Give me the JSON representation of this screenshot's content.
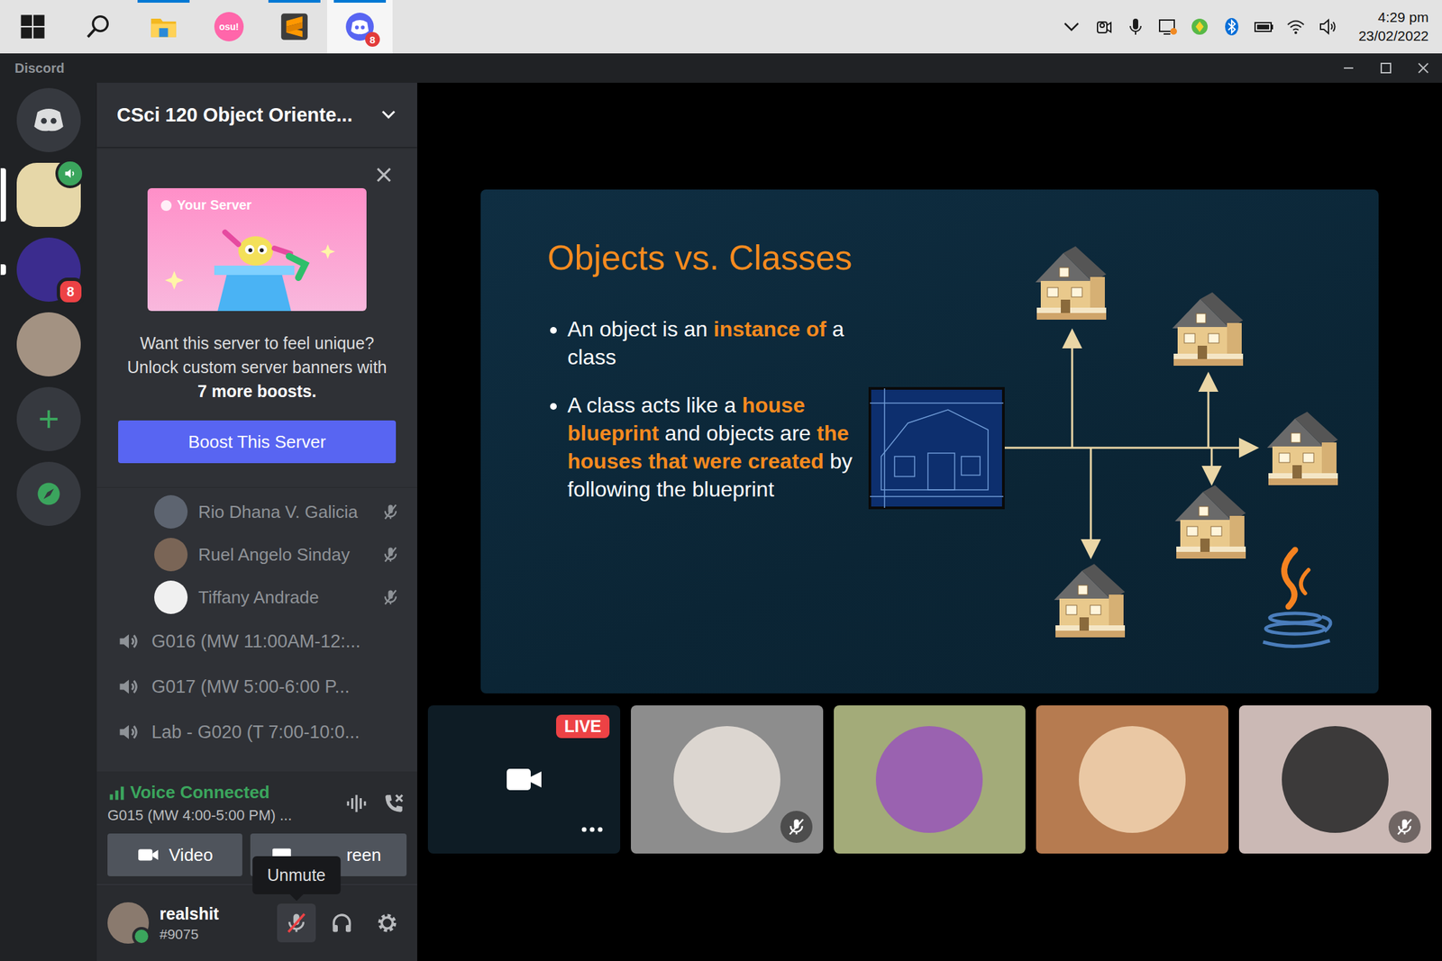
{
  "taskbar": {
    "apps": [
      {
        "kind": "start",
        "open": false,
        "active": false
      },
      {
        "kind": "search",
        "open": false,
        "active": false
      },
      {
        "kind": "explorer",
        "open": true,
        "active": false
      },
      {
        "kind": "osu",
        "open": false,
        "active": false,
        "label": "osu!"
      },
      {
        "kind": "sublime",
        "open": true,
        "active": false
      },
      {
        "kind": "discord",
        "open": true,
        "active": true,
        "badge": "8"
      }
    ],
    "clock": {
      "time": "4:29 pm",
      "date": "23/02/2022"
    }
  },
  "window": {
    "title": "Discord"
  },
  "servers": [
    {
      "kind": "home",
      "selected": false
    },
    {
      "kind": "server",
      "selected": true,
      "unread": false,
      "voice": true,
      "color": "#e6d7a8"
    },
    {
      "kind": "server",
      "selected": false,
      "unread": true,
      "voice": false,
      "badge": "8",
      "color": "#3b2c8e"
    },
    {
      "kind": "server",
      "selected": false,
      "unread": false,
      "voice": false,
      "color": "#a39282"
    },
    {
      "kind": "add",
      "selected": false
    },
    {
      "kind": "explore",
      "selected": false
    }
  ],
  "sidebar": {
    "server_name": "CSci 120 Object Oriente...",
    "boost_card": {
      "banner_label": "Your Server",
      "message": "Want this server to feel unique? Unlock custom server banners with",
      "highlight": "7 more boosts.",
      "button": "Boost This Server"
    },
    "voice_users": [
      {
        "name": "Rio Dhana V. Galicia",
        "muted": true,
        "color": "#5d6470"
      },
      {
        "name": "Ruel Angelo Sinday",
        "muted": true,
        "color": "#7a6556"
      },
      {
        "name": "Tiffany Andrade",
        "muted": true,
        "color": "#f0f0f0"
      }
    ],
    "channels": [
      {
        "name": "G016 (MW 11:00AM-12:..."
      },
      {
        "name": "G017 (MW 5:00-6:00 P..."
      },
      {
        "name": "Lab - G020 (T 7:00-10:0..."
      }
    ]
  },
  "voice_panel": {
    "status": "Voice Connected",
    "channel": "G015 (MW 4:00-5:00 PM) ...",
    "buttons": [
      {
        "label": "Video",
        "kind": "video"
      },
      {
        "label": "reen",
        "kind": "screen"
      }
    ]
  },
  "user_panel": {
    "name": "realshit",
    "tag": "#9075",
    "online": true,
    "muted": true,
    "tooltip": "Unmute"
  },
  "stage": {
    "slide": {
      "title": "Objects vs. Classes",
      "bullets": [
        [
          {
            "text": "An object is an ",
            "highlight": false
          },
          {
            "text": "instance of",
            "highlight": true
          },
          {
            "text": " a class",
            "highlight": false
          }
        ],
        [
          {
            "text": "A class acts like a ",
            "highlight": false
          },
          {
            "text": "house blueprint",
            "highlight": true
          },
          {
            "text": " and objects are ",
            "highlight": false
          },
          {
            "text": "the houses that were created",
            "highlight": true
          },
          {
            "text": " by following the blueprint",
            "highlight": false
          }
        ]
      ]
    },
    "tiles": [
      {
        "kind": "stream",
        "live": "LIVE",
        "color": "#0e1c25"
      },
      {
        "kind": "user",
        "muted": true,
        "color": "#8d8d8d",
        "avatar_color": "#dcd6d0"
      },
      {
        "kind": "user",
        "muted": false,
        "color": "#a3ab79",
        "avatar_color": "#9a62b0"
      },
      {
        "kind": "user",
        "muted": false,
        "color": "#b67b50",
        "avatar_color": "#eac8a4"
      },
      {
        "kind": "user",
        "muted": true,
        "color": "#cbb9b5",
        "avatar_color": "#3c3a3a"
      }
    ]
  }
}
